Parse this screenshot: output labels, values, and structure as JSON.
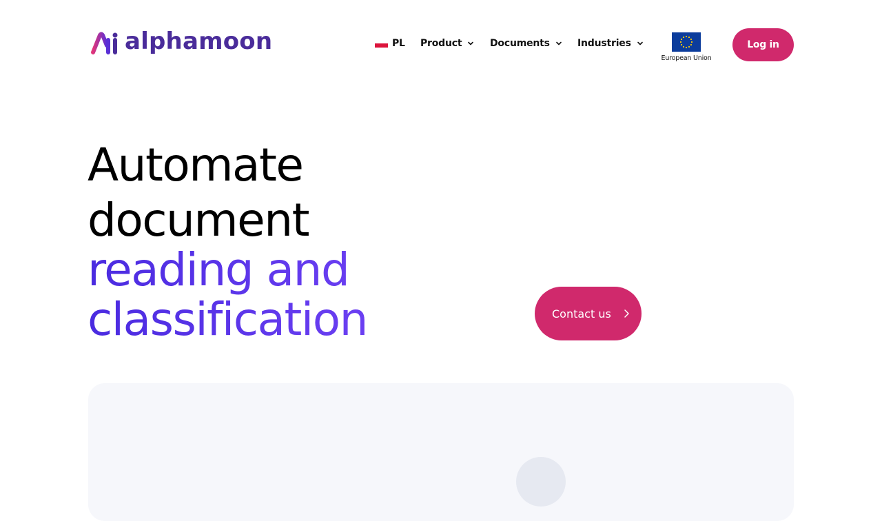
{
  "brand": {
    "name": "alphamoon",
    "logo_color": "#4a2c9a",
    "mark_gradient": [
      "#e0357a",
      "#5a2fd6"
    ]
  },
  "nav": {
    "language": {
      "label": "PL",
      "flag_icon": "poland-flag-icon"
    },
    "items": [
      {
        "label": "Product",
        "icon": "chevron-down-icon"
      },
      {
        "label": "Documents",
        "icon": "chevron-down-icon"
      },
      {
        "label": "Industries",
        "icon": "chevron-down-icon"
      }
    ],
    "eu_badge": {
      "label": "European Union",
      "icon": "eu-flag-icon"
    },
    "login_label": "Log in"
  },
  "hero": {
    "lines": [
      "Automate",
      "document",
      "reading and",
      "classification"
    ],
    "cta_label": "Contact us",
    "cta_icon": "chevron-right-icon"
  },
  "colors": {
    "accent": "#d0296c",
    "headline_accent": "#5a35e8",
    "panel_bg": "#f6f7fb"
  }
}
